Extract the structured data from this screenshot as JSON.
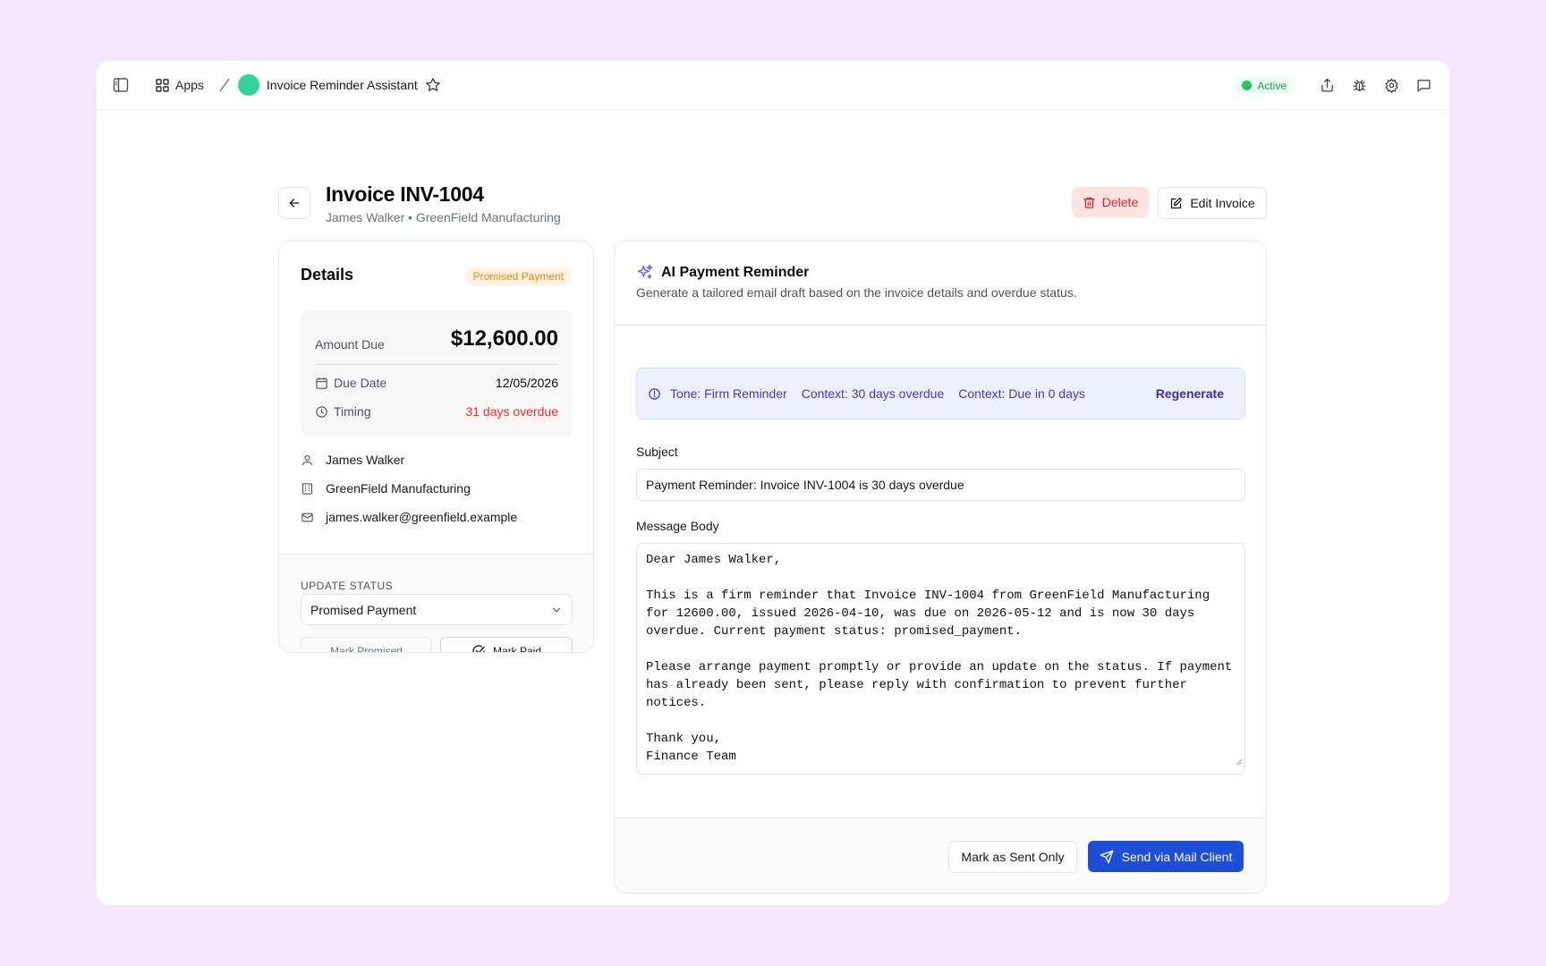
{
  "topbar": {
    "apps_label": "Apps",
    "app_name": "Invoice Reminder Assistant",
    "status": "Active",
    "icons": [
      "sidebar-toggle-icon",
      "grid-icon",
      "star-icon",
      "share-icon",
      "bug-icon",
      "gear-icon",
      "chat-icon"
    ],
    "app_color": "#34d399"
  },
  "header": {
    "title": "Invoice INV-1004",
    "subtitle": "James Walker • GreenField Manufacturing",
    "delete_label": "Delete",
    "edit_label": "Edit Invoice"
  },
  "details": {
    "title": "Details",
    "status_badge": "Promised Payment",
    "amount_label": "Amount Due",
    "amount_value": "$12,600.00",
    "due_date_label": "Due Date",
    "due_date_value": "12/05/2026",
    "timing_label": "Timing",
    "timing_value": "31 days overdue",
    "contact_name": "James Walker",
    "company": "GreenField Manufacturing",
    "email": "james.walker@greenfield.example",
    "update_status_label": "UPDATE STATUS",
    "status_select_value": "Promised Payment",
    "mark_promised_label": "Mark Promised",
    "mark_paid_label": "Mark Paid"
  },
  "ai": {
    "title": "AI Payment Reminder",
    "subtitle": "Generate a tailored email draft based on the invoice details and overdue status.",
    "tone": "Tone: Firm Reminder",
    "context1": "Context: 30 days overdue",
    "context2": "Context: Due in 0 days",
    "regenerate_label": "Regenerate",
    "subject_label": "Subject",
    "subject_value": "Payment Reminder: Invoice INV-1004 is 30 days overdue",
    "body_label": "Message Body",
    "body_value": "Dear James Walker,\n\nThis is a firm reminder that Invoice INV-1004 from GreenField Manufacturing\nfor 12600.00, issued 2026-04-10, was due on 2026-05-12 and is now 30 days\noverdue. Current payment status: promised_payment.\n\nPlease arrange payment promptly or provide an update on the status. If payment\nhas already been sent, please reply with confirmation to prevent further\nnotices.\n\nThank you,\nFinance Team",
    "mark_sent_label": "Mark as Sent Only",
    "send_label": "Send via Mail Client"
  },
  "colors": {
    "background": "#f3e6fd",
    "accent": "#1d4ed8",
    "danger": "#dc2626",
    "overdue": "#ef2b2b",
    "badge_orange": "#e8890c",
    "active_green": "#22c55e"
  }
}
